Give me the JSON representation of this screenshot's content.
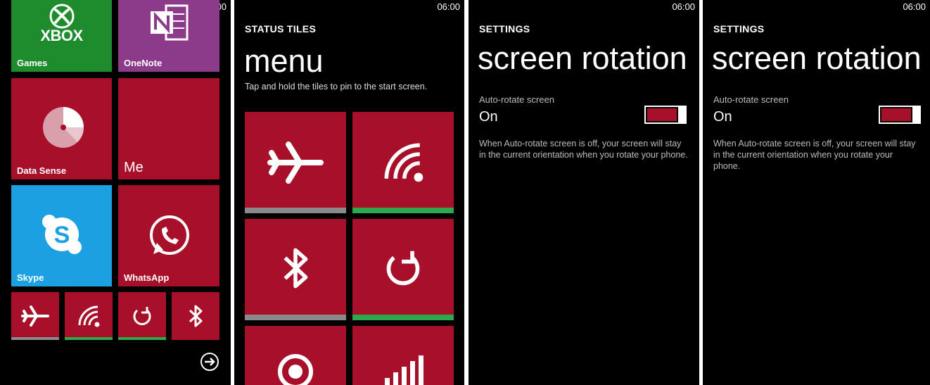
{
  "status": {
    "time": "06:00"
  },
  "start_screen": {
    "tiles": {
      "xbox_logo": "XBOX",
      "games": "Games",
      "onenote": "OneNote",
      "datasense": "Data Sense",
      "me": "Me",
      "skype": "Skype",
      "whatsapp": "WhatsApp"
    },
    "colors": {
      "green": "#1e8c2d",
      "purple": "#8c3a8a",
      "red": "#a8102a",
      "blue": "#1ba1e2",
      "bar_on": "#2ea84d",
      "bar_off": "#8a8a8a"
    }
  },
  "status_tiles": {
    "section": "STATUS TILES",
    "title": "menu",
    "caption": "Tap and hold the tiles to pin to the start screen."
  },
  "rotation_1": {
    "section": "SETTINGS",
    "title": "screen rotation",
    "label": "Auto-rotate screen",
    "value": "On",
    "description": "When Auto-rotate screen is off, your screen will stay in the current orientation when you rotate your phone."
  },
  "rotation_2": {
    "section": "SETTINGS",
    "title": "screen rotation",
    "label": "Auto-rotate screen",
    "value": "On",
    "description": "When Auto-rotate screen is off, your screen will stay in the current orientation when you rotate your phone."
  }
}
